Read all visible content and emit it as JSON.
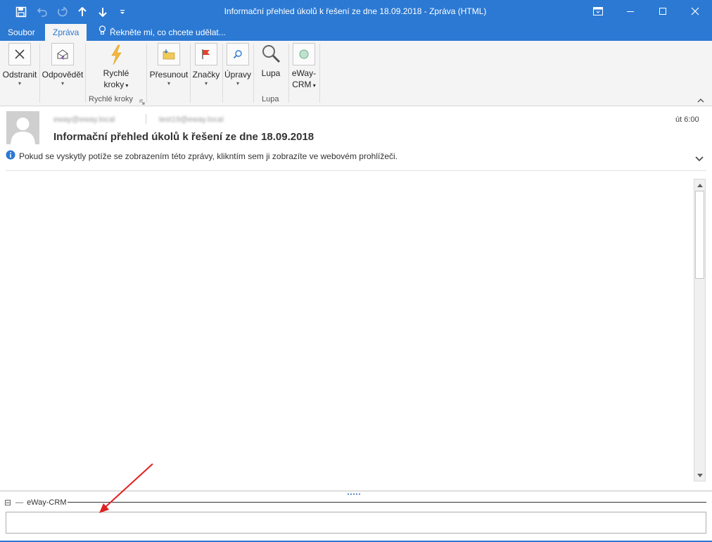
{
  "window": {
    "title": "Informační přehled úkolů k řešení ze dne 18.09.2018 - Zpráva (HTML)"
  },
  "tabs": [
    {
      "label": "Soubor",
      "active": false
    },
    {
      "label": "Zpráva",
      "active": true
    }
  ],
  "tell_me": {
    "placeholder": "Řekněte mi, co chcete udělat..."
  },
  "ribbon": {
    "delete_label": "Odstranit",
    "respond_label": "Odpovědět",
    "quick_steps_label_1": "Rychlé",
    "quick_steps_label_2": "kroky",
    "quick_steps_group": "Rychlé kroky",
    "move_label": "Přesunout",
    "tags_label": "Značky",
    "editing_label": "Úpravy",
    "zoom_label": "Lupa",
    "zoom_group": "Lupa",
    "eway_label_1": "eWay-",
    "eway_label_2": "CRM"
  },
  "message": {
    "from": "eway@eway.local",
    "to": "test19@eway.local",
    "time": "út 6:00",
    "subject": "Informační přehled úkolů k řešení ze dne 18.09.2018",
    "info_bar": "Pokud se vyskytly potíže se zobrazením této zprávy, klikntím sem ji zobrazíte ve webovém prohlížeči."
  },
  "crm_pane": {
    "toggle": "⊟",
    "dash": "—",
    "title": "eWay-CRM"
  },
  "colors": {
    "accent": "#2b79d3",
    "ribbon_bg": "#f4f4f4",
    "annotation_arrow": "#e02020"
  },
  "icons": [
    "save-icon",
    "undo-icon",
    "redo-icon",
    "up-arrow-icon",
    "down-arrow-icon",
    "customize-icon",
    "ribbon-display-icon",
    "minimize-icon",
    "maximize-icon",
    "close-icon",
    "lightbulb-icon",
    "delete-icon",
    "respond-icon",
    "lightning-icon",
    "move-folder-icon",
    "flag-icon",
    "search-edit-icon",
    "magnifier-icon",
    "eway-circle-icon",
    "info-icon",
    "chevron-down-icon",
    "collapse-ribbon-icon",
    "annotation-arrow"
  ]
}
